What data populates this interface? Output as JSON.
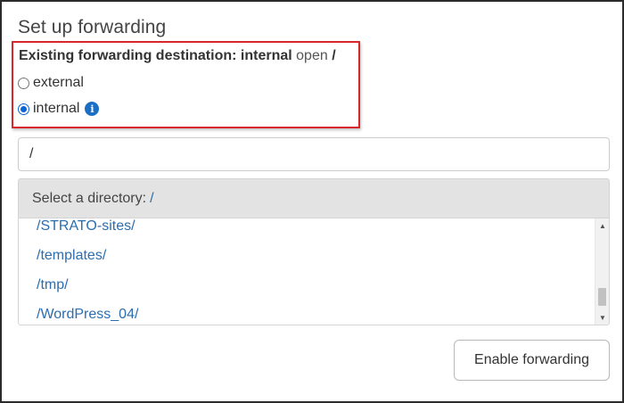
{
  "title": "Set up forwarding",
  "existing": {
    "label": "Existing forwarding destination:",
    "type": "internal",
    "action": "open",
    "path": "/"
  },
  "options": [
    {
      "label": "external",
      "checked": false
    },
    {
      "label": "internal",
      "checked": true
    }
  ],
  "info_icon": {
    "name": "info-icon",
    "glyph": "i"
  },
  "path_input": {
    "value": "/"
  },
  "directory": {
    "header_label": "Select a directory:",
    "header_path": "/",
    "items": [
      "/STRATO-sites/",
      "/templates/",
      "/tmp/",
      "/WordPress_04/"
    ],
    "scroll_position": 0.78
  },
  "enable_button": "Enable forwarding",
  "colors": {
    "accent": "#1a6fc4",
    "link": "#2a6db0",
    "highlight_border": "#d9262b"
  }
}
